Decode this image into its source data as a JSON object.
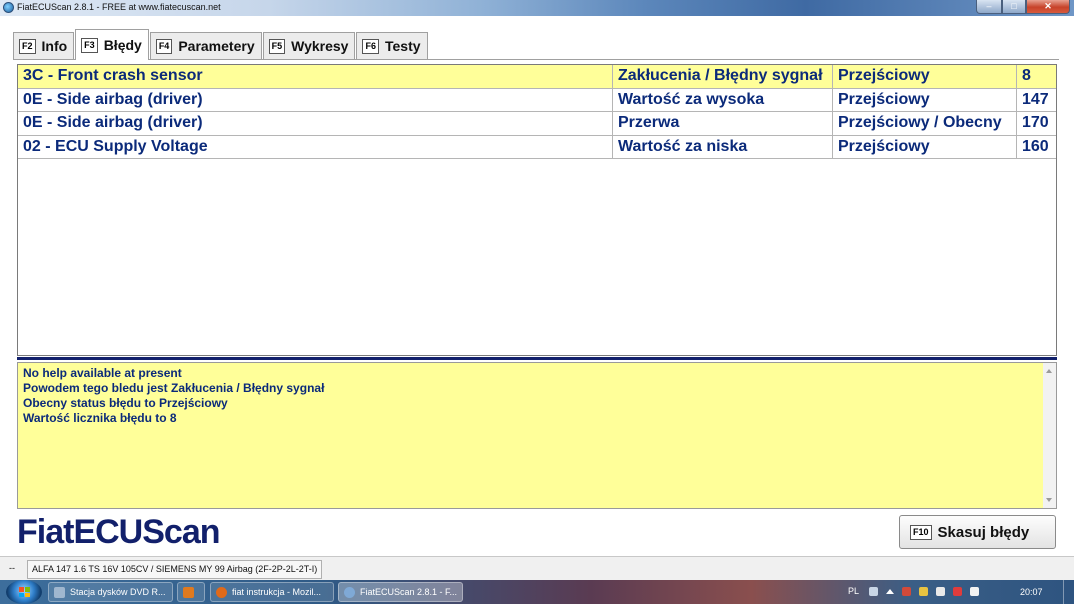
{
  "window": {
    "title": "FiatECUScan 2.8.1 - FREE at www.fiatecuscan.net",
    "minimize_glyph": "–",
    "maximize_glyph": "□",
    "close_glyph": "✕"
  },
  "tabs": [
    {
      "key": "F2",
      "label": "Info"
    },
    {
      "key": "F3",
      "label": "Błędy"
    },
    {
      "key": "F4",
      "label": "Parametery"
    },
    {
      "key": "F5",
      "label": "Wykresy"
    },
    {
      "key": "F6",
      "label": "Testy"
    }
  ],
  "active_tab": "Błędy",
  "faults": [
    {
      "code": "3C - Front crash sensor",
      "type": "Zakłucenia / Błędny sygnał",
      "status": "Przejściowy",
      "count": "8"
    },
    {
      "code": "0E - Side airbag (driver)",
      "type": "Wartość za wysoka",
      "status": "Przejściowy",
      "count": "147"
    },
    {
      "code": "0E - Side airbag (driver)",
      "type": "Przerwa",
      "status": "Przejściowy / Obecny",
      "count": "170"
    },
    {
      "code": "02 - ECU Supply Voltage",
      "type": "Wartość za niska",
      "status": "Przejściowy",
      "count": "160"
    }
  ],
  "help": {
    "lines": [
      "No help available at present",
      "Powodem tego bledu jest Zakłucenia / Błędny sygnał",
      "Obecny status błędu to Przejściowy",
      "Wartość licznika błędu to 8"
    ]
  },
  "logo": "FiatECUScan",
  "clear_button": {
    "key": "F10",
    "label": "Skasuj błędy"
  },
  "status_bar": {
    "dash": "--",
    "vehicle": "ALFA 147 1.6 TS 16V 105CV / SIEMENS MY 99 Airbag (2F-2P-2L-2T-I)"
  },
  "taskbar": {
    "items": [
      {
        "label": "Stacja dysków DVD R...",
        "icon_color": "#9fb7cf"
      },
      {
        "label": "",
        "icon_color": "#e07a1f"
      },
      {
        "label": "fiat instrukcja - Mozil...",
        "icon_color": "#e06a1a"
      },
      {
        "label": "FiatECUScan 2.8.1 - F...",
        "icon_color": "#7fa9d6"
      }
    ],
    "language": "PL",
    "clock": "20:07"
  },
  "colors": {
    "selected_row": "#ffff99",
    "text_blue": "#0b2a7a",
    "accent_navy": "#12206b"
  }
}
